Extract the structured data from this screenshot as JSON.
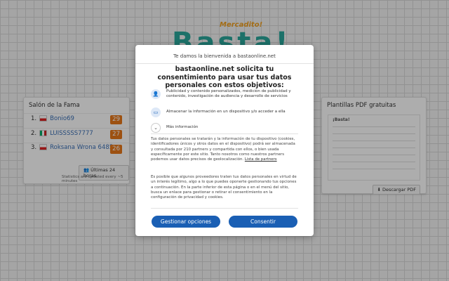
{
  "brand": {
    "subtitle": "Mercadito!",
    "name": "Basta!"
  },
  "fame": {
    "title": "Salón de la Fama",
    "rows": [
      {
        "rank": "1.",
        "flag": "poland",
        "player": "Bonio69",
        "score": "29"
      },
      {
        "rank": "2.",
        "flag": "mexico",
        "player": "LUISSSSS7777",
        "score": "27"
      },
      {
        "rank": "3.",
        "flag": "poland",
        "player": "Roksana Wrona 6485",
        "score": "26"
      }
    ],
    "hours_button": "Últimas 24 horas",
    "stats_note": "Statistics are updated every ~5 minutes"
  },
  "pdf": {
    "title": "Plantillas PDF gratuitas",
    "preview_title": "¡Basta!",
    "download_button": "Descargar PDF"
  },
  "modal": {
    "welcome": "Te damos la bienvenida a bastaonline.net",
    "heading": "bastaonline.net solicita tu consentimiento para usar tus datos personales con estos objetivos:",
    "purposes": [
      {
        "icon": "person-icon",
        "text": "Publicidad y contenido personalizados, medición de publicidad y contenido, investigación de audiencia y desarrollo de servicios"
      },
      {
        "icon": "device-icon",
        "text": "Almacenar la información en un dispositivo y/o acceder a ella"
      }
    ],
    "more_info": "Más información",
    "paragraph1": "Tus datos personales se tratarán y la información de tu dispositivo (cookies, identificadores únicos y otros datos en el dispositivo) podrá ser almacenada y consultada por 210 partners y compartida con ellos, o bien usada específicamente por este sitio. Tanto nosotros como nuestros partners podemos usar datos precisos de geolocalización.",
    "partners_link": "Lista de partners",
    "paragraph2": "Es posible que algunos proveedores traten tus datos personales en virtud de un interés legítimo, algo a lo que puedes oponerte gestionando tus opciones a continuación. En la parte inferior de esta página o en el menú del sitio, busca un enlace para gestionar o retirar el consentimiento en la configuración de privacidad y cookies.",
    "manage_button": "Gestionar opciones",
    "consent_button": "Consentir"
  },
  "colors": {
    "primary_button": "#1a5fb4",
    "score_badge": "#e8781a",
    "brand": "#2aa79b",
    "brand_accent": "#f0a020"
  }
}
